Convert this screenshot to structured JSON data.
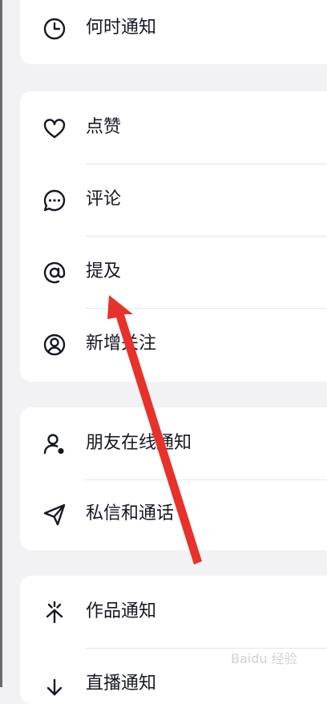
{
  "settings": {
    "when_to_notify": {
      "label": "何时通知",
      "icon": "clock-icon"
    },
    "interactions": [
      {
        "label": "点赞",
        "icon": "heart-icon"
      },
      {
        "label": "评论",
        "icon": "comment-icon"
      },
      {
        "label": "提及",
        "icon": "at-icon"
      },
      {
        "label": "新增关注",
        "icon": "user-circle-icon"
      }
    ],
    "social": [
      {
        "label": "朋友在线通知",
        "icon": "user-online-icon"
      },
      {
        "label": "私信和通话",
        "icon": "paper-plane-icon"
      }
    ],
    "content": [
      {
        "label": "作品通知",
        "icon": "sparkle-icon"
      },
      {
        "label": "直播通知",
        "icon": "live-icon"
      }
    ]
  },
  "annotation": {
    "arrow_color": "#e8312b"
  },
  "watermark": {
    "text": "Baidu 经验"
  }
}
